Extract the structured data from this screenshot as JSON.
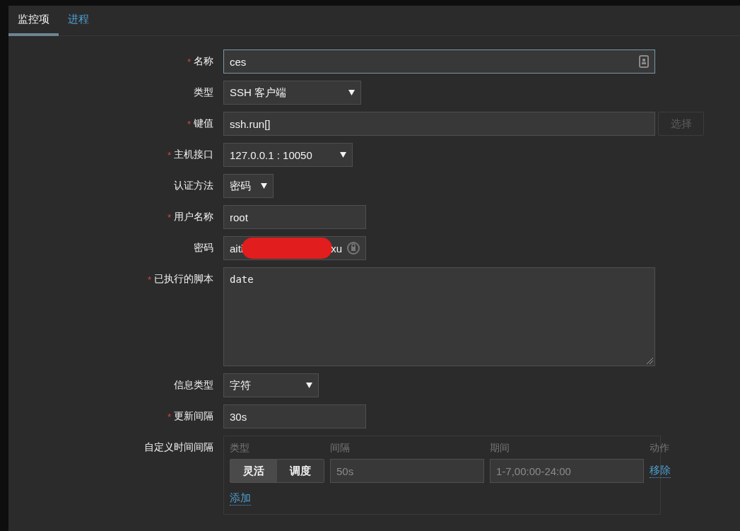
{
  "tabs": [
    {
      "label": "监控项",
      "selected": true
    },
    {
      "label": "进程",
      "selected": false
    }
  ],
  "fields": [
    {
      "kind": "text",
      "label": "名称",
      "mark": "*",
      "value": "ces",
      "focused": true
    },
    {
      "kind": "select",
      "label": "类型",
      "value": "SSH 客户端"
    },
    {
      "kind": "text",
      "label": "键值",
      "mark": "*",
      "value": "ssh.run[]",
      "focused": false,
      "button": {
        "label": "选择",
        "disabled": true
      }
    },
    {
      "kind": "select",
      "label": "主机接口",
      "mark": "*",
      "value": "127.0.0.1 : 10050"
    },
    {
      "kind": "select",
      "label": "认证方法",
      "value": "密码"
    },
    {
      "kind": "text",
      "label": "用户名称",
      "mark": "*",
      "value": "root",
      "focused": false
    },
    {
      "kind": "password",
      "label": "密码",
      "value_start": "aiti",
      "value_end": "xu"
    },
    {
      "kind": "textarea",
      "label": "已执行的脚本",
      "mark": "*",
      "value": "date"
    },
    {
      "kind": "select",
      "label": "信息类型",
      "value": "字符"
    },
    {
      "kind": "text",
      "label": "更新间隔",
      "mark": "*",
      "value": "30s",
      "focused": false
    },
    {
      "kind": "intervals",
      "label": "自定义时间间隔",
      "columns": [
        "类型",
        "间隔",
        "期间",
        "动作"
      ],
      "rows": [
        {
          "modes": [
            {
              "label": "灵活",
              "selected": true
            },
            {
              "label": "调度",
              "selected": false
            }
          ],
          "interval_placeholder": "50s",
          "period_placeholder": "1-7,00:00-24:00",
          "action": "移除"
        }
      ],
      "add": "添加"
    }
  ]
}
